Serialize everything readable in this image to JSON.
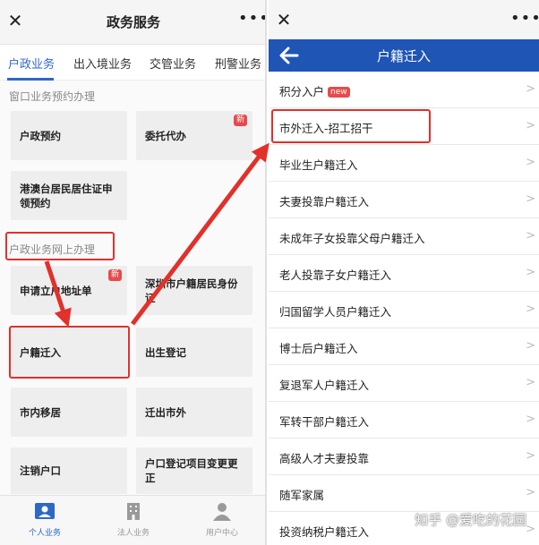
{
  "left": {
    "title": "政务服务",
    "tabs": [
      "户政业务",
      "出入境业务",
      "交管业务",
      "刑警业务"
    ],
    "section1": "窗口业务预约办理",
    "section2": "户政业务网上办理",
    "cards1": [
      "户政预约",
      "委托代办",
      "港澳台居民居住证申领预约"
    ],
    "cards2": [
      "申请立户地址单",
      "深圳市户籍居民身份证",
      "户籍迁入",
      "出生登记",
      "市内移居",
      "迁出市外",
      "注销户口",
      "户口登记项目变更更正"
    ],
    "new_badge": "新",
    "nav": [
      "个人业务",
      "法人业务",
      "用户中心"
    ]
  },
  "right": {
    "title": "户籍迁入",
    "new_tag": "new",
    "items": [
      "积分入户",
      "市外迁入-招工招干",
      "毕业生户籍迁入",
      "夫妻投靠户籍迁入",
      "未成年子女投靠父母户籍迁入",
      "老人投靠子女户籍迁入",
      "归国留学人员户籍迁入",
      "博士后户籍迁入",
      "复退军人户籍迁入",
      "军转干部户籍迁入",
      "高级人才夫妻投靠",
      "随军家属",
      "投资纳税户籍迁入"
    ]
  },
  "watermark": "知乎 @爱吃的花园",
  "colors": {
    "accent": "#2f67c6",
    "header_blue": "#1f55b5",
    "highlight_red": "#e2302a",
    "badge_red": "#e84a4a"
  },
  "icons": [
    "close-icon",
    "more-icon",
    "back-arrow-icon",
    "chevron-right-icon",
    "person-card-icon",
    "building-icon",
    "user-icon"
  ]
}
